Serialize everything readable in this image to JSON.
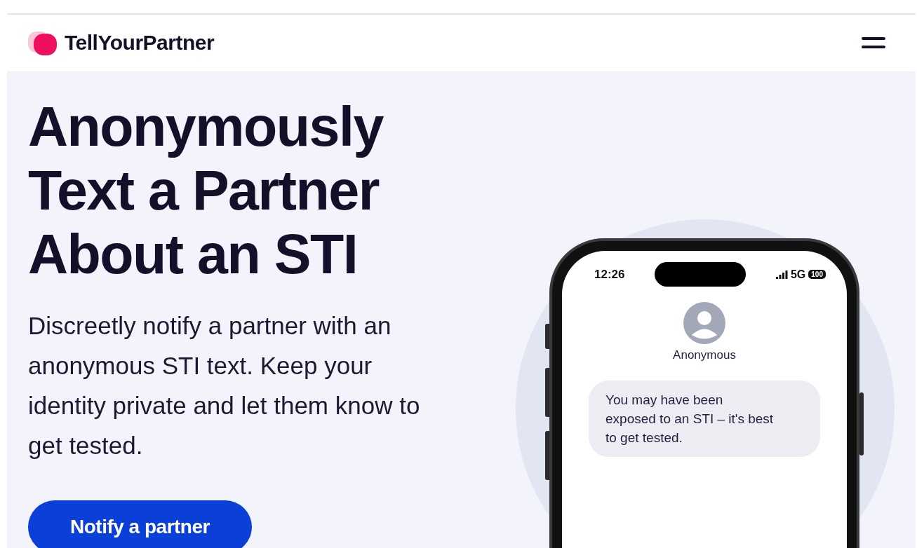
{
  "header": {
    "brand": "TellYourPartner"
  },
  "hero": {
    "headline_lines": [
      "Anonymously",
      "Text a Partner",
      "About an STI"
    ],
    "description": "Discreetly notify a partner with an anonymous STI text. Keep your identity private and let them know to get tested.",
    "button": "Notify a partner"
  },
  "phone": {
    "time": "12:26",
    "network": "5G",
    "battery": "100",
    "contact": "Anonymous",
    "message": "You may have been exposed to an STI – it's best to get tested."
  }
}
